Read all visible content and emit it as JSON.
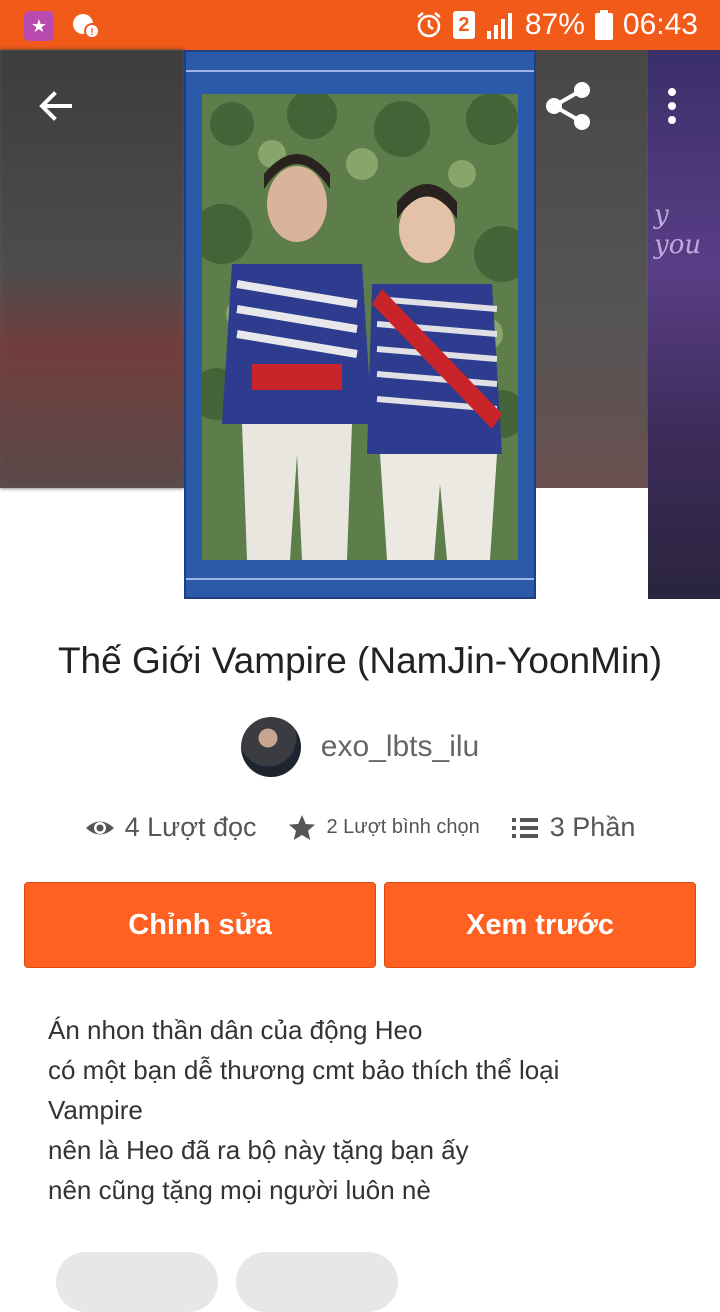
{
  "status_bar": {
    "sim_slot": "2",
    "battery": "87%",
    "time": "06:43"
  },
  "story": {
    "title": "Thế Giới Vampire (NamJin-YoonMin)",
    "author": "exo_lbts_ilu",
    "reads": "4 Lượt đọc",
    "votes": "2 Lượt bình chọn",
    "parts": "3 Phần"
  },
  "actions": {
    "edit_label": "Chỉnh sửa",
    "preview_label": "Xem trước"
  },
  "description": [
    "Án nhon thần dân của động Heo",
    "có một bạn dễ thương cmt bảo thích thể loại",
    "Vampire",
    "nên là Heo đã ra bộ này tặng bạn ấy",
    "nên cũng tặng mọi người luôn nè"
  ],
  "icons": {
    "back": "back-arrow-icon",
    "share": "share-icon",
    "more": "more-vertical-icon",
    "reads": "eye-icon",
    "votes": "star-icon",
    "parts": "list-icon"
  },
  "colors": {
    "accent": "#ff6122",
    "status_bar": "#f25a1a"
  }
}
